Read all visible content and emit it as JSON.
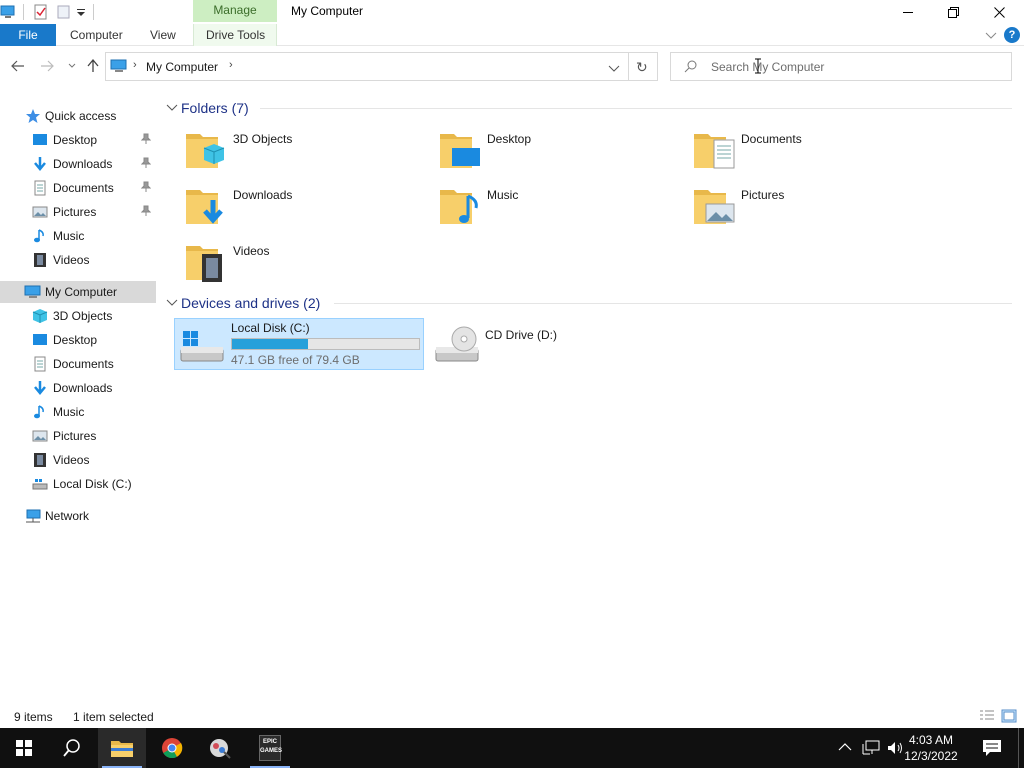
{
  "window": {
    "title": "My Computer",
    "context_tab": "Manage"
  },
  "ribbon": {
    "tabs": [
      "File",
      "Computer",
      "View",
      "Drive Tools"
    ]
  },
  "address": {
    "path": "My Computer",
    "search_placeholder": "Search My Computer"
  },
  "nav": {
    "quick_access": "Quick access",
    "quick_items": [
      {
        "label": "Desktop",
        "icon": "desktop-icon",
        "pinned": true
      },
      {
        "label": "Downloads",
        "icon": "downloads-icon",
        "pinned": true
      },
      {
        "label": "Documents",
        "icon": "documents-icon",
        "pinned": true
      },
      {
        "label": "Pictures",
        "icon": "pictures-icon",
        "pinned": true
      },
      {
        "label": "Music",
        "icon": "music-icon",
        "pinned": false
      },
      {
        "label": "Videos",
        "icon": "videos-icon",
        "pinned": false
      }
    ],
    "this_pc": "My Computer",
    "pc_items": [
      {
        "label": "3D Objects",
        "icon": "3d-objects-icon"
      },
      {
        "label": "Desktop",
        "icon": "desktop-icon"
      },
      {
        "label": "Documents",
        "icon": "documents-icon"
      },
      {
        "label": "Downloads",
        "icon": "downloads-icon"
      },
      {
        "label": "Music",
        "icon": "music-icon"
      },
      {
        "label": "Pictures",
        "icon": "pictures-icon"
      },
      {
        "label": "Videos",
        "icon": "videos-icon"
      },
      {
        "label": "Local Disk (C:)",
        "icon": "local-disk-icon"
      }
    ],
    "network": "Network"
  },
  "content": {
    "folders_header": "Folders (7)",
    "folders": [
      {
        "label": "3D Objects",
        "icon": "3d-objects-folder-icon"
      },
      {
        "label": "Desktop",
        "icon": "desktop-folder-icon"
      },
      {
        "label": "Documents",
        "icon": "documents-folder-icon"
      },
      {
        "label": "Downloads",
        "icon": "downloads-folder-icon"
      },
      {
        "label": "Music",
        "icon": "music-folder-icon"
      },
      {
        "label": "Pictures",
        "icon": "pictures-folder-icon"
      },
      {
        "label": "Videos",
        "icon": "videos-folder-icon"
      }
    ],
    "drives_header": "Devices and drives (2)",
    "drives": [
      {
        "label": "Local Disk (C:)",
        "free_text": "47.1 GB free of 79.4 GB",
        "used_fraction": 0.407,
        "selected": true
      },
      {
        "label": "CD Drive (D:)"
      }
    ]
  },
  "status": {
    "items": "9 items",
    "selected": "1 item selected"
  },
  "taskbar": {
    "time": "4:03 AM",
    "date": "12/3/2022",
    "epic_label": "EPIC GAMES"
  },
  "colors": {
    "accent": "#1979ca",
    "selection": "#cce8ff",
    "drive_bar": "#26a0da",
    "manage_tab": "#cdeec2"
  }
}
